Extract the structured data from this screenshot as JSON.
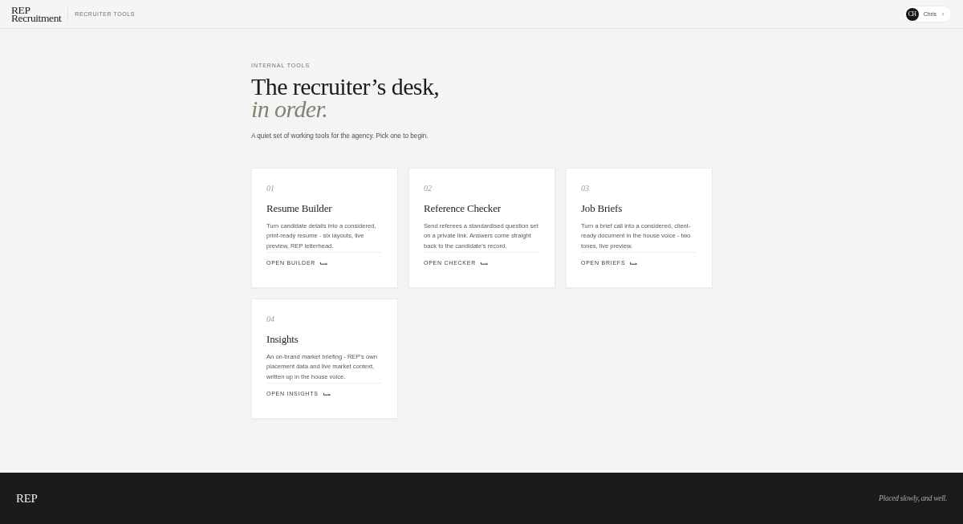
{
  "header": {
    "logo": {
      "line_1": "REP",
      "line_2": "Recruitment"
    },
    "section": "RECRUITER TOOLS",
    "user": {
      "initials": "CH",
      "name": "Chris"
    }
  },
  "intro": {
    "eyebrow": "INTERNAL TOOLS",
    "heading": "The recruiter’s desk,",
    "heading_accent": "in order.",
    "subtitle": "A quiet set of working tools for the agency. Pick one to begin."
  },
  "tools": [
    {
      "number": "01",
      "title": "Resume Builder",
      "description": "Turn candidate details into a considered, print-ready resume - six layouts, live preview, REP letterhead.",
      "link": "OPEN BUILDER"
    },
    {
      "number": "02",
      "title": "Reference Checker",
      "description": "Send referees a standardised question set on a private link. Answers come straight back to the candidate’s record.",
      "link": "OPEN CHECKER"
    },
    {
      "number": "03",
      "title": "Job Briefs",
      "description": "Turn a brief call into a considered, client-ready document in the house voice - two tones, live preview.",
      "link": "OPEN BRIEFS"
    },
    {
      "number": "04",
      "title": "Insights",
      "description": "An on-brand market briefing - REP’s own placement data and live market context, written up in the house voice.",
      "link": "OPEN INSIGHTS"
    }
  ],
  "footer": {
    "logo": "REP",
    "tagline": "Placed slowly, and well."
  }
}
